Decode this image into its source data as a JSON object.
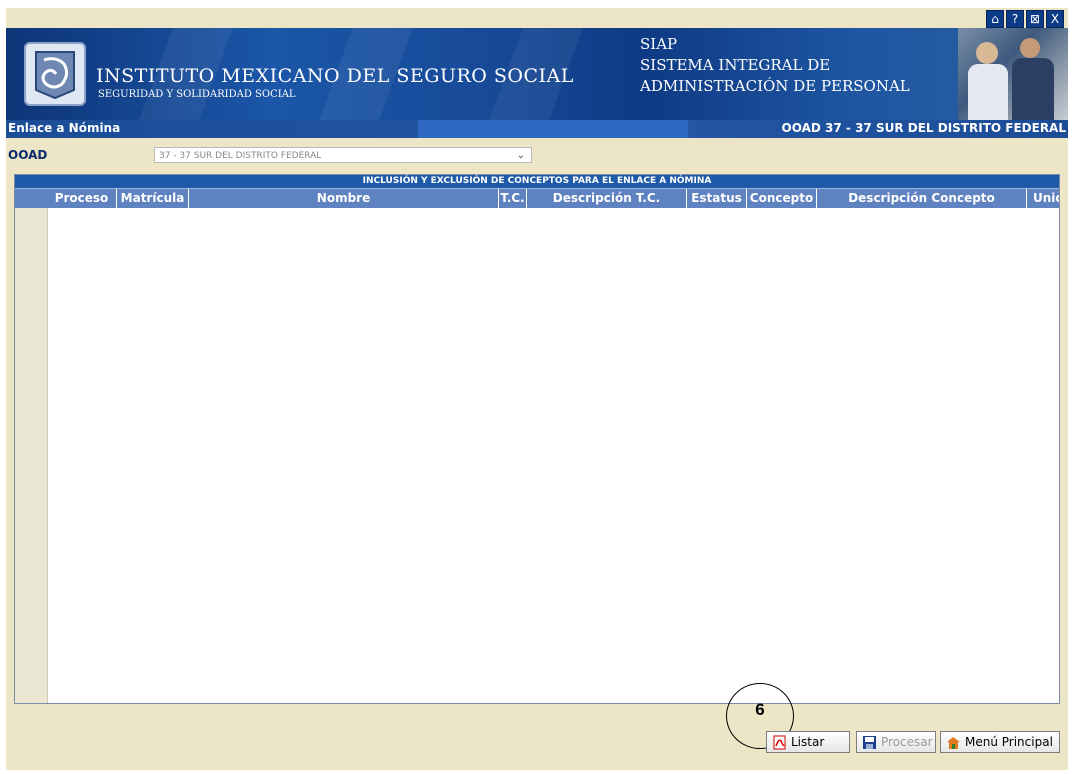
{
  "window_buttons": [
    "⌂",
    "?",
    "⊠",
    "X"
  ],
  "banner": {
    "institution": "INSTITUTO MEXICANO DEL SEGURO SOCIAL",
    "subtitle": "SEGURIDAD Y SOLIDARIDAD SOCIAL",
    "system_acronym": "SIAP",
    "system_line1": "SISTEMA INTEGRAL DE",
    "system_line2": "ADMINISTRACIÓN DE PERSONAL"
  },
  "titlebar": {
    "section": "Enlace a Nómina",
    "ooad_info": "OOAD 37 - 37 SUR DEL DISTRITO FEDERAL"
  },
  "ooad": {
    "label": "OOAD",
    "selected": "37 - 37 SUR DEL DISTRITO FEDERAL"
  },
  "grid": {
    "title": "INCLUSIÓN Y EXCLUSIÓN DE CONCEPTOS PARA EL ENLACE A NÓMINA",
    "columns": [
      "Proceso",
      "Matrícula",
      "Nombre",
      "T.C.",
      "Descripción T.C.",
      "Estatus",
      "Concepto",
      "Descripción Concepto",
      "Unid"
    ]
  },
  "callout": {
    "number": "6"
  },
  "buttons": {
    "listar": "Listar",
    "procesar": "Procesar",
    "menu": "Menú Principal"
  },
  "colors": {
    "banner": "#1b56a8",
    "header": "#5f82c1",
    "background": "#ece6c7"
  }
}
